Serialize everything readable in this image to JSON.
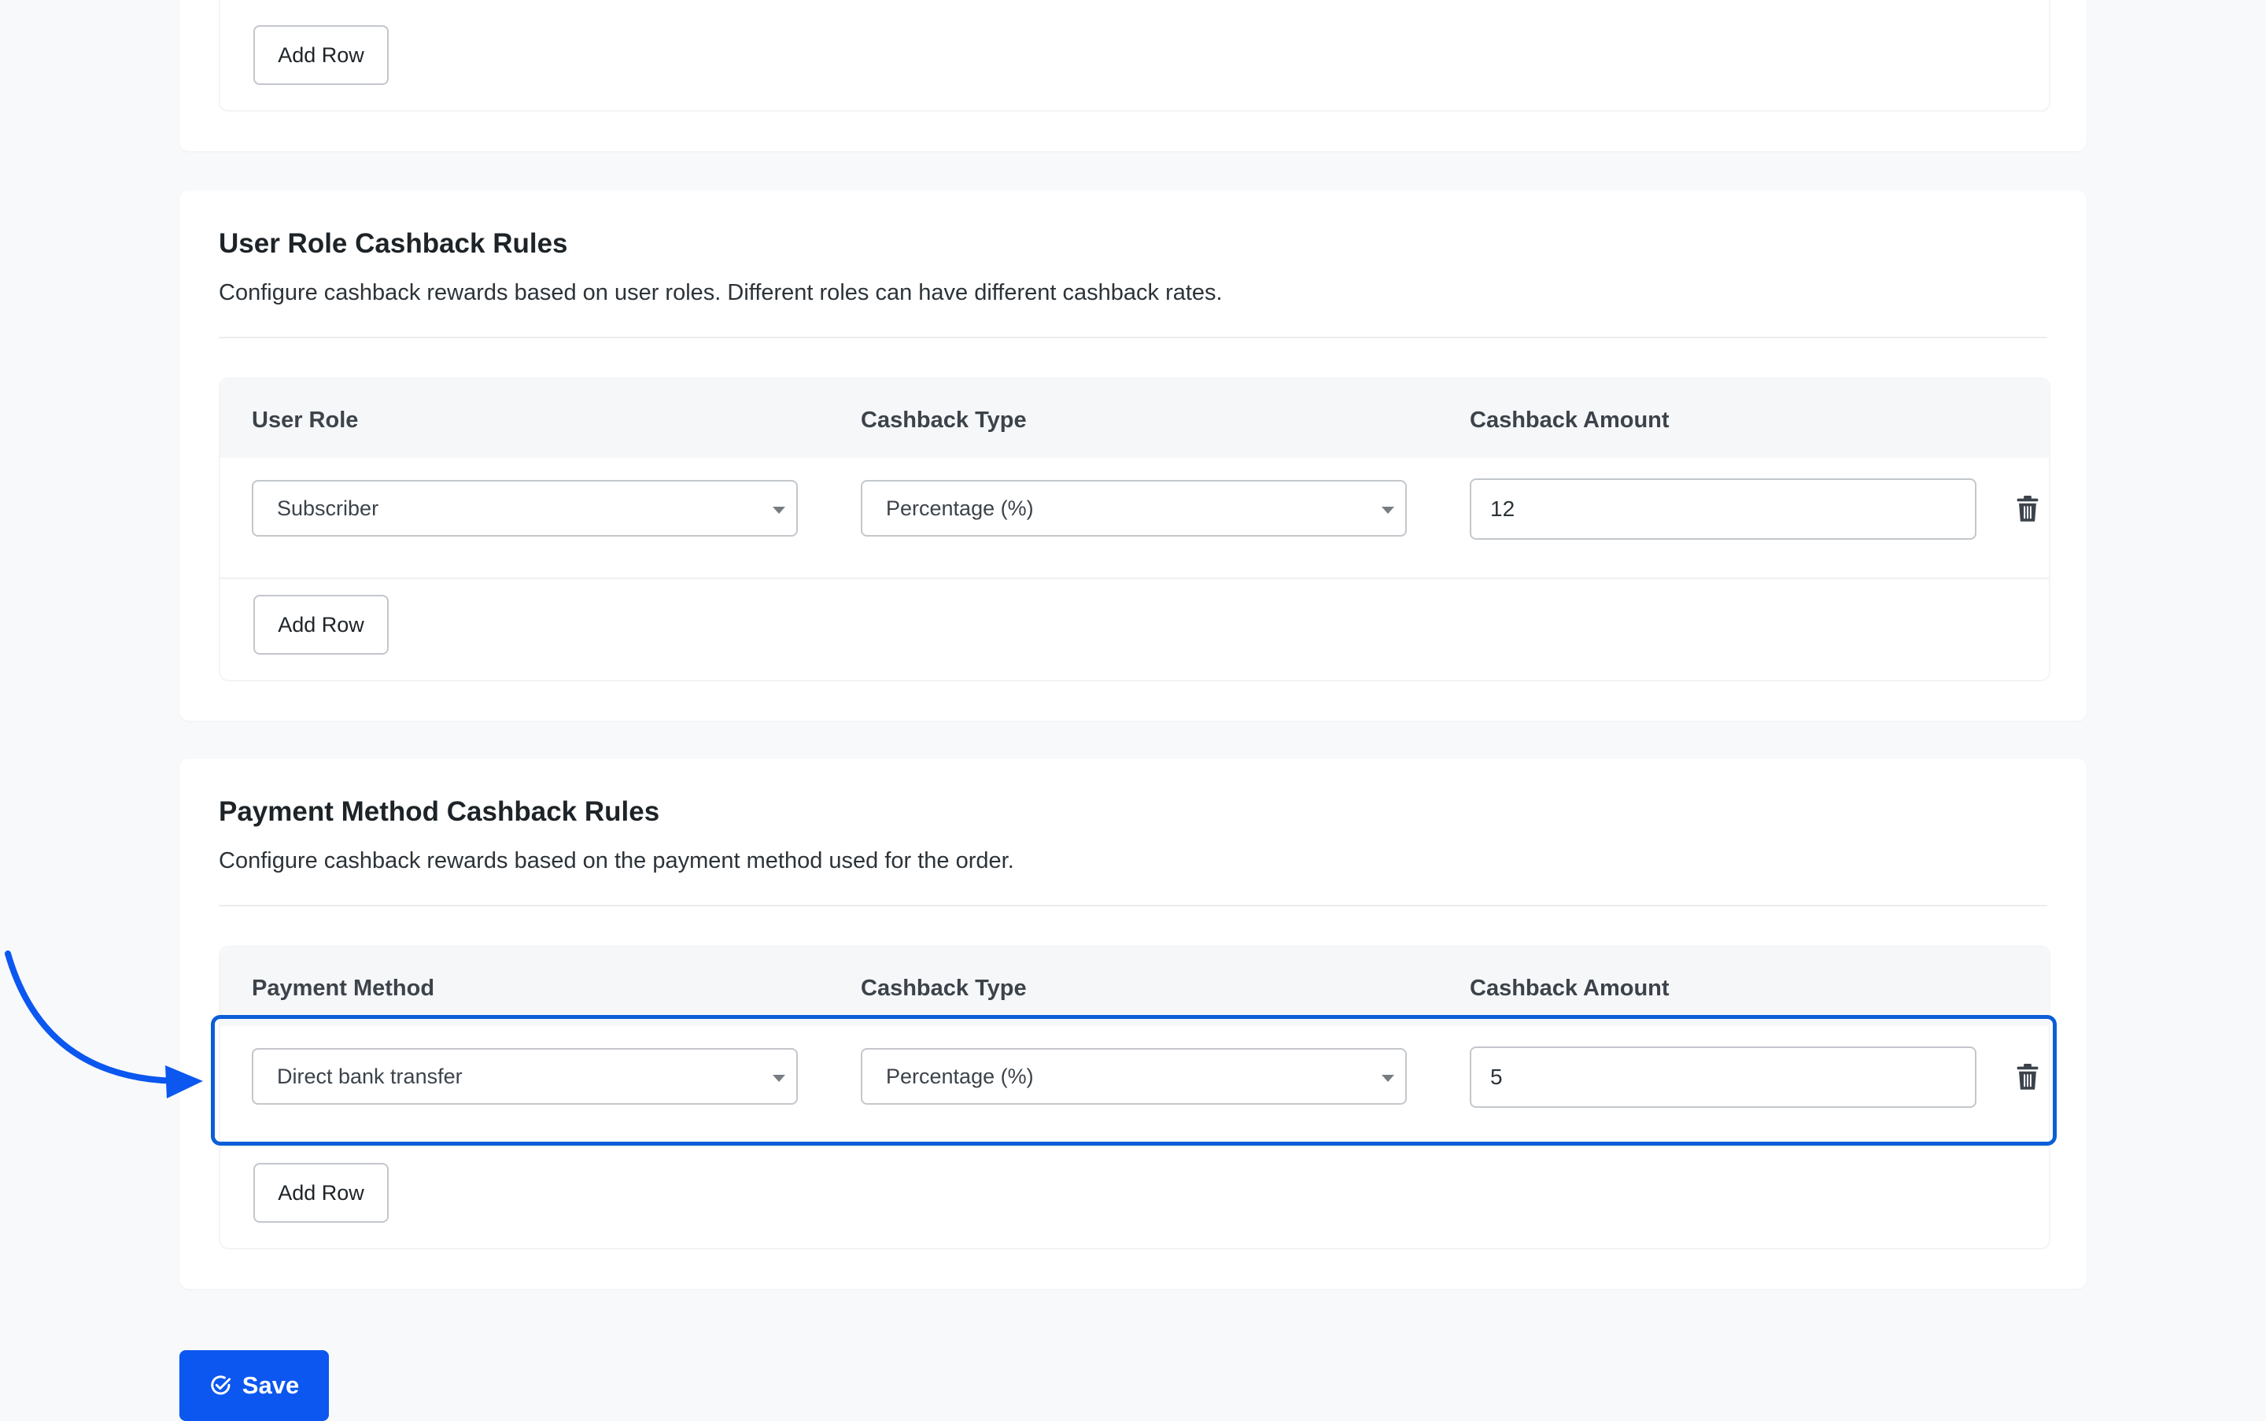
{
  "section_top": {
    "add_row_label": "Add Row"
  },
  "user_role_section": {
    "title": "User Role Cashback Rules",
    "description": "Configure cashback rewards based on user roles. Different roles can have different cashback rates.",
    "columns": [
      "User Role",
      "Cashback Type",
      "Cashback Amount"
    ],
    "rows": [
      {
        "role": "Subscriber",
        "cashback_type": "Percentage (%)",
        "amount": "12"
      }
    ],
    "add_row_label": "Add Row"
  },
  "payment_section": {
    "title": "Payment Method Cashback Rules",
    "description": "Configure cashback rewards based on the payment method used for the order.",
    "columns": [
      "Payment Method",
      "Cashback Type",
      "Cashback Amount"
    ],
    "rows": [
      {
        "method": "Direct bank transfer",
        "cashback_type": "Percentage (%)",
        "amount": "5"
      }
    ],
    "add_row_label": "Add Row"
  },
  "save_label": "Save",
  "colors": {
    "accent": "#0b57f0",
    "highlight": "#0b5ed7",
    "icon": "#3c434a"
  },
  "icons": {
    "delete": "trash-icon",
    "save": "check-circle-icon",
    "dropdown": "caret-down-icon"
  }
}
